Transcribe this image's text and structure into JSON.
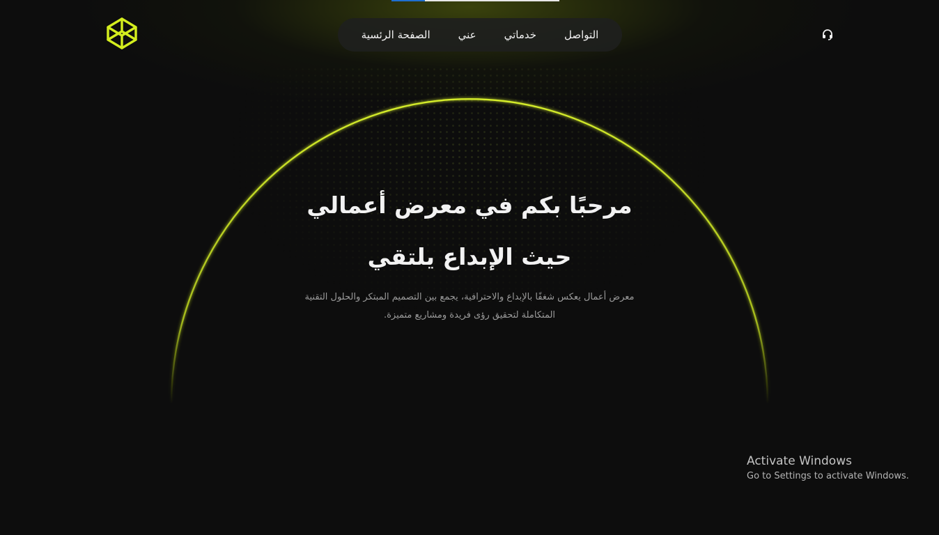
{
  "nav": {
    "items": [
      {
        "label": "التواصل"
      },
      {
        "label": "خدماتي"
      },
      {
        "label": "عني"
      },
      {
        "label": "الصفحة الرئسية"
      }
    ]
  },
  "hero": {
    "title_line1": "مرحبًا بكم في معرض أعمالي",
    "title_line2": "حيث الإبداع يلتقي",
    "subtitle_line1": "معرض أعمال يعكس شغفًا بالإبداع والاحترافية، يجمع بين التصميم المبتكر والحلول التقنية",
    "subtitle_line2": "المتكاملة لتحقيق رؤى فريدة ومشاريع متميزة."
  },
  "os_overlay": {
    "title": "Activate Windows",
    "message": "Go to Settings to activate Windows."
  },
  "icons": {
    "logo": "codepen-cube-icon",
    "support": "headset-icon"
  },
  "colors": {
    "accent": "#c8e62a",
    "background": "#0d0d0d",
    "nav_bg": "#1e201e"
  }
}
